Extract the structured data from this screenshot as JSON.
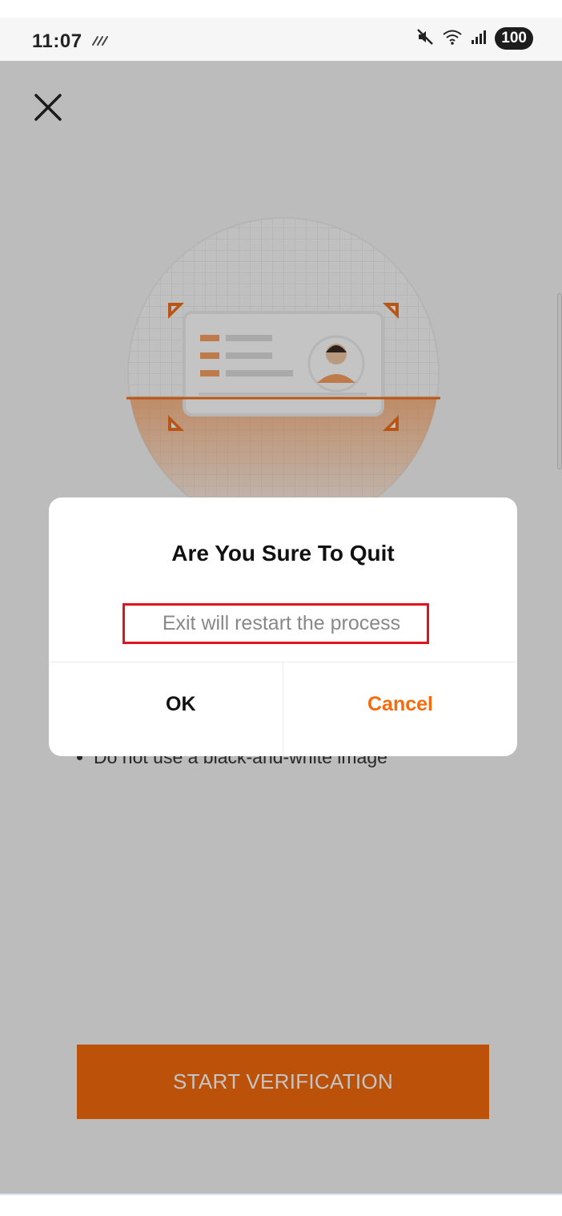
{
  "status_bar": {
    "time": "11:07",
    "battery": "100",
    "icons": [
      "notification-icon",
      "mute-icon",
      "wifi-icon",
      "signal-icon",
      "battery-icon"
    ]
  },
  "screen": {
    "close_icon": "close-icon",
    "tips": [
      "Do not use a black-and-white image"
    ],
    "start_button_label": "START VERIFICATION",
    "accent_color": "#f56b0d"
  },
  "dialog": {
    "title": "Are You Sure To Quit",
    "message": "Exit will restart the process",
    "ok_label": "OK",
    "cancel_label": "Cancel",
    "highlight_color": "#e0141c"
  }
}
